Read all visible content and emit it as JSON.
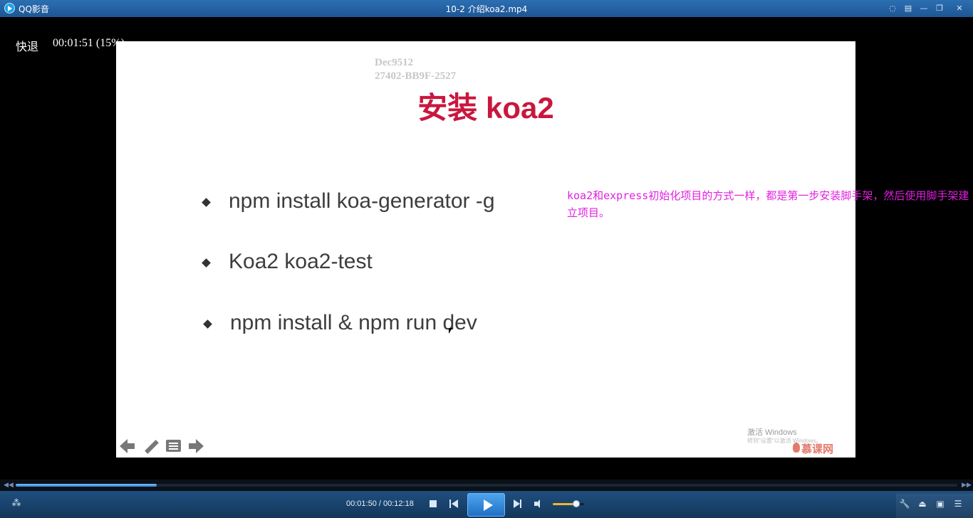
{
  "titlebar": {
    "app_name": "QQ影音",
    "window_title": "10-2 介绍koa2.mp4",
    "buttons": [
      "chat-icon",
      "menu-icon",
      "minimize-icon",
      "restore-icon",
      "close-icon"
    ],
    "glyphs": {
      "chat": "◌",
      "menu": "▤",
      "minimize": "—",
      "restore": "❐",
      "close": "✕"
    }
  },
  "osd": {
    "label": "快退",
    "time": "00:01:51 (15%)"
  },
  "slide": {
    "watermark_line1": "Dec9512",
    "watermark_line2": "27402-BB9F-2527",
    "title": "安装 koa2",
    "bullets": [
      "npm install koa-generator -g",
      "Koa2 koa2-test",
      "npm install & npm run dev"
    ],
    "activate_text": "激活 Windows",
    "activate_sub": "转到\"设置\"以激活 Windows。",
    "brand": "慕课网"
  },
  "subtitle": "koa2和express初始化项目的方式一样，都是第一步安装脚手架，然后使用脚手架建立项目。",
  "playback": {
    "progress_fraction": 0.15,
    "current_time": "00:01:50",
    "total_time": "00:12:18",
    "time_display": "00:01:50 / 00:12:18",
    "volume_fraction": 0.75
  },
  "controls": {
    "left_icon": "footprint-icon",
    "seek_back_glyph": "◀◀",
    "seek_fwd_glyph": "▶▶",
    "left_glyph": "⁂",
    "right_glyphs": {
      "tools": "🔧",
      "eject": "⏏",
      "screen": "▣",
      "list": "☰"
    }
  }
}
